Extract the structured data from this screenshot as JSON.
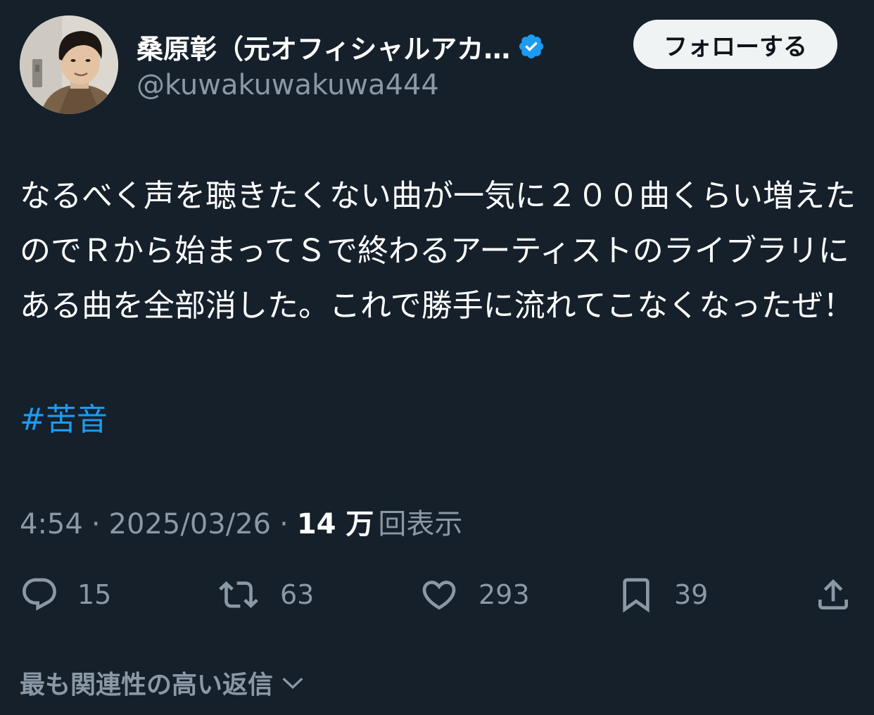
{
  "author": {
    "display_name": "桑原彰（元オフィシャルアカ…",
    "handle": "@kuwakuwakuwa444",
    "verified": true,
    "avatar_icon": "profile-photo"
  },
  "follow_button": {
    "label": "フォローする"
  },
  "tweet": {
    "text": "なるべく声を聴きたくない曲が一気に２００曲くらい増えたのでＲから始まってＳで終わるアーティストのライブラリにある曲を全部消した。これで勝手に流れてこなくなったぜ！",
    "hashtag": "#苦音"
  },
  "meta": {
    "time": "4:54",
    "separator": "·",
    "date": "2025/03/26",
    "views_count": "14 万",
    "views_label": "回表示"
  },
  "actions": {
    "reply": {
      "icon": "reply-icon",
      "count": "15"
    },
    "retweet": {
      "icon": "retweet-icon",
      "count": "63"
    },
    "like": {
      "icon": "heart-icon",
      "count": "293"
    },
    "bookmark": {
      "icon": "bookmark-icon",
      "count": "39"
    },
    "share": {
      "icon": "share-icon"
    }
  },
  "replies_sort": {
    "label": "最も関連性の高い返信",
    "icon": "chevron-down-icon"
  },
  "colors": {
    "background": "#15202b",
    "text": "#ffffff",
    "muted": "#8b98a5",
    "link": "#1d9bf0",
    "button_bg": "#eff3f4",
    "button_text": "#0f1419",
    "verified": "#1d9bf0"
  }
}
